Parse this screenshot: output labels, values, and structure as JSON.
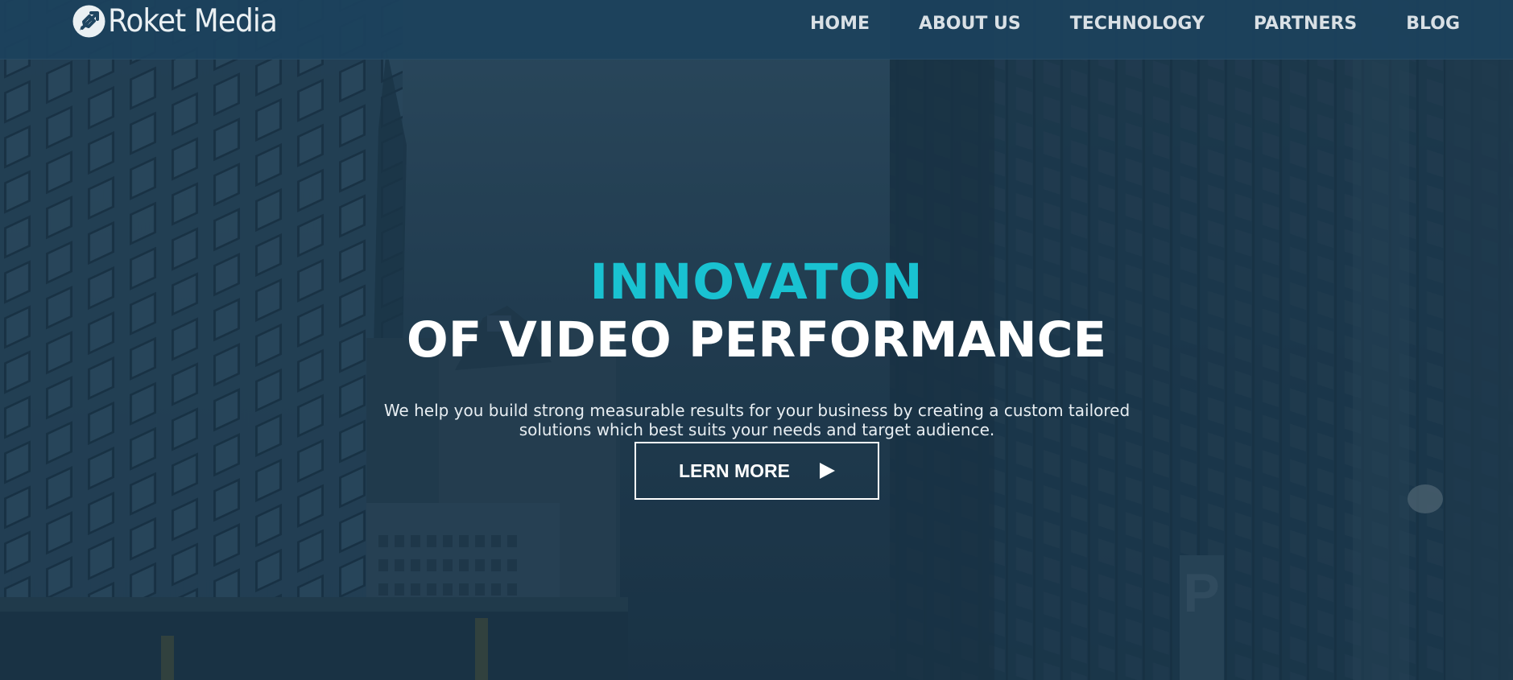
{
  "brand": {
    "name": "Roket Media",
    "logo_icon": "rocket-logo-icon"
  },
  "nav": {
    "items": [
      {
        "label": "HOME"
      },
      {
        "label": "ABOUT US"
      },
      {
        "label": "TECHNOLOGY"
      },
      {
        "label": "PARTNERS"
      },
      {
        "label": "BLOG"
      }
    ]
  },
  "hero": {
    "headline_accent": "INNOVATON",
    "headline_main": "OF VIDEO PERFORMANCE",
    "subtitle": "We help you build strong measurable results for your business by creating a custom tailored solutions which best suits your needs and target audience.",
    "cta_label": "LERN MORE",
    "cta_icon": "play-icon"
  },
  "colors": {
    "accent": "#19c2d1",
    "nav_background": "#1c425c",
    "overlay": "#163042",
    "text": "#ffffff"
  }
}
